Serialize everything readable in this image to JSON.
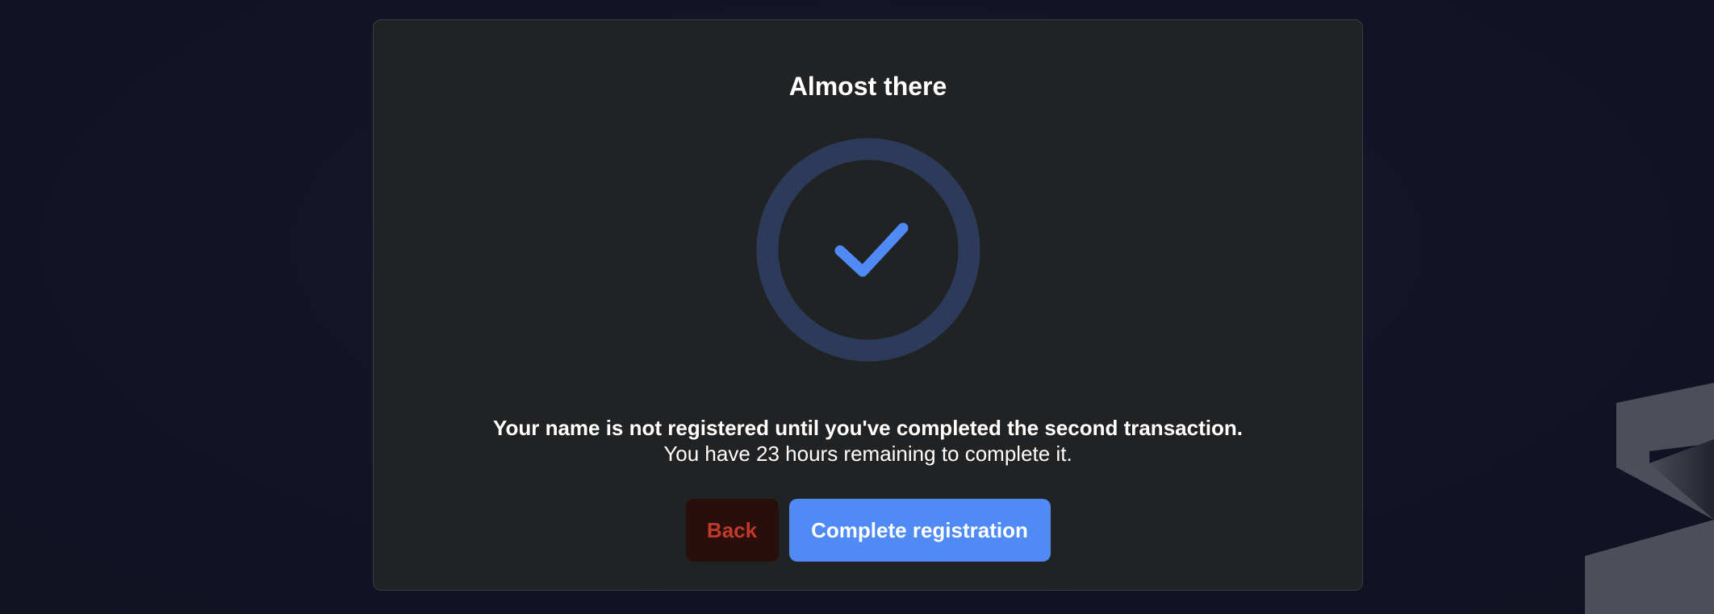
{
  "dialog": {
    "title": "Almost there",
    "message_strong": "Your name is not registered until you've completed the second transaction.",
    "message_sub": "You have 23 hours remaining to complete it.",
    "status_icon": "check-circle-icon"
  },
  "actions": {
    "back_label": "Back",
    "primary_label": "Complete registration"
  },
  "colors": {
    "accent": "#4f8af5",
    "danger": "#c0392b",
    "card_bg": "#212224",
    "page_bg": "#141428"
  }
}
